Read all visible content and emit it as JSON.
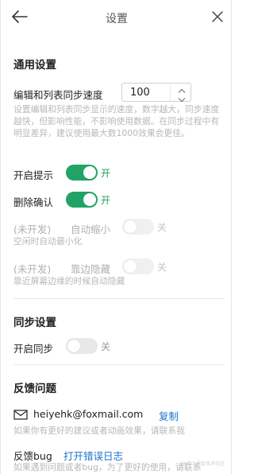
{
  "header": {
    "title": "设置"
  },
  "general": {
    "title": "通用设置",
    "speed_label": "编辑和列表同步速度",
    "speed_value": "100",
    "speed_desc": "设置编辑和列表同步显示的速度，数字越大，同步速度越快，但影响性能，不影响使用数据。在同步过程中有明显差异，建议使用最大数1000效果会更佳。",
    "open_tip": {
      "label": "开启提示",
      "state": "开",
      "on": true
    },
    "delete_confirm": {
      "label": "删除确认",
      "state": "开",
      "on": true
    },
    "auto_minimize": {
      "prefix": "(未开发)",
      "label": "自动缩小",
      "state": "关",
      "on": false,
      "desc": "空闲时自动最小化"
    },
    "edge_hide": {
      "prefix": "(未开发)",
      "label": "靠边隐藏",
      "state": "关",
      "on": false,
      "desc": "靠近屏幕边缘的时候自动隐藏"
    }
  },
  "sync": {
    "title": "同步设置",
    "open_sync": {
      "label": "开启同步",
      "state": "关",
      "on": false
    }
  },
  "feedback": {
    "title": "反馈问题",
    "email": "heiyehk@foxmail.com",
    "copy_label": "复制",
    "email_desc": "如果你有更好的建议或者动画效果，请联系我",
    "bug_label": "反馈bug",
    "bug_link": "打开错误日志",
    "bug_desc": "如果遇到问题或者bug，为了更好的使用，请联系"
  },
  "watermark": "@稀土掘金技术社区",
  "colors": {
    "accent": "#21a366",
    "link": "#1a73c8",
    "muted": "#b8b8b8"
  }
}
